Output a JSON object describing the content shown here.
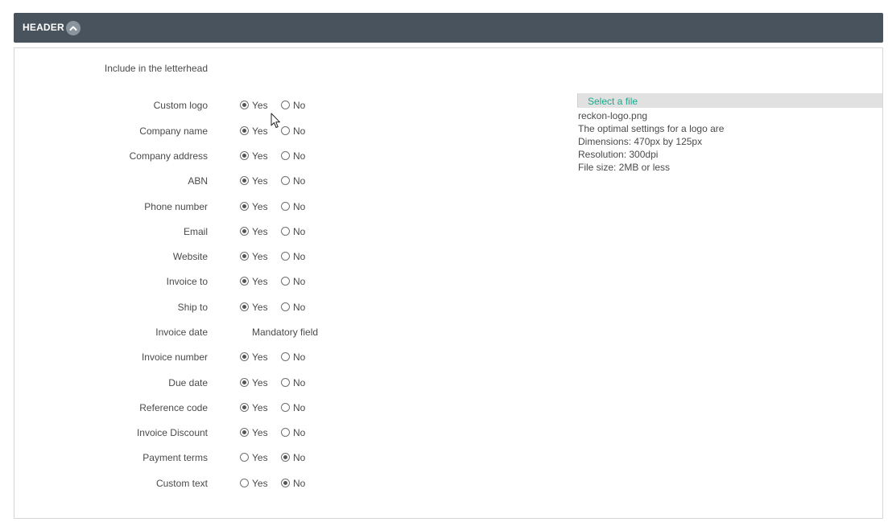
{
  "section": {
    "title": "HEADER",
    "collapse_icon": "chevron-up-icon"
  },
  "intro": "Include in the letterhead",
  "options": {
    "yes_label": "Yes",
    "no_label": "No"
  },
  "rows": [
    {
      "label": "Custom logo",
      "selected": "yes"
    },
    {
      "label": "Company name",
      "selected": "yes"
    },
    {
      "label": "Company address",
      "selected": "yes"
    },
    {
      "label": "ABN",
      "selected": "yes"
    },
    {
      "label": "Phone number",
      "selected": "yes"
    },
    {
      "label": "Email",
      "selected": "yes"
    },
    {
      "label": "Website",
      "selected": "yes"
    },
    {
      "label": "Invoice to",
      "selected": "yes"
    },
    {
      "label": "Ship to",
      "selected": "yes"
    },
    {
      "label": "Invoice date",
      "mandatory": "Mandatory field"
    },
    {
      "label": "Invoice number",
      "selected": "yes"
    },
    {
      "label": "Due date",
      "selected": "yes"
    },
    {
      "label": "Reference code",
      "selected": "yes"
    },
    {
      "label": "Invoice Discount",
      "selected": "yes"
    },
    {
      "label": "Payment terms",
      "selected": "no"
    },
    {
      "label": "Custom text",
      "selected": "no"
    }
  ],
  "logo_upload": {
    "select_label": "Select a file",
    "file_name": "reckon-logo.png",
    "info_lines": [
      "The optimal settings for a logo are",
      "Dimensions: 470px by 125px",
      "Resolution: 300dpi",
      "File size: 2MB or less"
    ]
  },
  "colors": {
    "header_bg": "#48535d",
    "link": "#1ca98c",
    "file_bar": "#e1e1e1"
  }
}
